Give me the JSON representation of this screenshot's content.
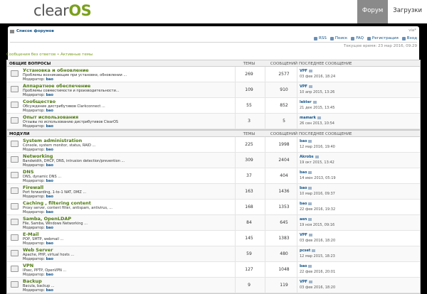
{
  "header": {
    "logo_prefix": "clear",
    "logo_suffix": "OS",
    "nav": [
      {
        "label": "Форум",
        "active": true
      },
      {
        "label": "Загрузки",
        "active": false
      }
    ]
  },
  "breadcrumbs": {
    "home": "Список форумов",
    "right": "via*",
    "toolbar": [
      "RSS",
      "Поиск",
      "FAQ",
      "Регистрация",
      "Вход"
    ],
    "time": "Текущее время: 23 мар 2016, 09:29"
  },
  "quicklinks": "Сообщения без ответов • Активные темы",
  "columns": {
    "topics": "ТЕМЫ",
    "posts": "СООБЩЕНИЙ",
    "last": "ПОСЛЕДНЕЕ СООБЩЕНИЕ"
  },
  "sections": [
    {
      "title": "ОБЩИЕ ВОПРОСЫ",
      "forums": [
        {
          "name": "Установка и обновление",
          "desc": "Проблемы возникающие при установке, обновлении ...",
          "mod_label": "Модератор:",
          "mod": "bao",
          "topics": "269",
          "posts": "2577",
          "last_by": "VPF",
          "last_date": "03 фев 2016, 18:24"
        },
        {
          "name": "Аппаратное обеспечение",
          "desc": "Проблемы совместимости и производительности...",
          "mod_label": "Модератор:",
          "mod": "bao",
          "topics": "109",
          "posts": "910",
          "last_by": "VPF",
          "last_date": "10 апр 2015, 13:26"
        },
        {
          "name": "Сообщество",
          "desc": "Обсуждение дистрибутивов Clarkconnect ...",
          "mod_label": "Модератор:",
          "mod": "bao",
          "topics": "55",
          "posts": "852",
          "last_by": "lekter",
          "last_date": "21 дек 2015, 13:45"
        },
        {
          "name": "Опыт использования",
          "desc": "Отзывы по использованию дистрибутивов ClearOS",
          "mod_label": "Модератор:",
          "mod": "bao",
          "topics": "3",
          "posts": "5",
          "last_by": "mamark",
          "last_date": "26 сен 2013, 10:54"
        }
      ]
    },
    {
      "title": "МОДУЛИ",
      "forums": [
        {
          "name": "System administration",
          "desc": "Console, system monitor, status, RAID ...",
          "mod_label": "Модератор:",
          "mod": "bao",
          "topics": "225",
          "posts": "1998",
          "last_by": "bao",
          "last_date": "12 мар 2016, 19:40"
        },
        {
          "name": "Networking",
          "desc": "Bandwidth, DHCP, DNS, intrusion detection/prevention ...",
          "mod_label": "Модератор:",
          "mod": "bao",
          "topics": "309",
          "posts": "2404",
          "last_by": "Akrobs",
          "last_date": "19 окт 2015, 13:42"
        },
        {
          "name": "DNS",
          "desc": "DNS, dynamic DNS ...",
          "mod_label": "Модератор:",
          "mod": "bao",
          "topics": "37",
          "posts": "404",
          "last_by": "bao",
          "last_date": "14 июн 2013, 05:19"
        },
        {
          "name": "Firewall",
          "desc": "Port forwarding, 1-to-1 NAT, DMZ ...",
          "mod_label": "Модератор:",
          "mod": "bao",
          "topics": "163",
          "posts": "1436",
          "last_by": "bao",
          "last_date": "10 мар 2016, 09:37"
        },
        {
          "name": "Caching , filtering content",
          "desc": "Proxy server, content filter, antispam, antivirus, ...",
          "mod_label": "Модератор:",
          "mod": "bao",
          "topics": "168",
          "posts": "1353",
          "last_by": "bao",
          "last_date": "22 фев 2016, 19:32"
        },
        {
          "name": "Samba, OpenLDAP",
          "desc": "File, Samba, Windows Networking ...",
          "mod_label": "Модератор:",
          "mod": "bao",
          "topics": "84",
          "posts": "645",
          "last_by": "aen",
          "last_date": "19 ноя 2015, 09:16"
        },
        {
          "name": "E-Mail",
          "desc": "POP, SMTP, webmail ...",
          "mod_label": "Модератор:",
          "mod": "bao",
          "topics": "145",
          "posts": "1383",
          "last_by": "VPF",
          "last_date": "03 фев 2016, 18:20"
        },
        {
          "name": "Web Server",
          "desc": "Apache, PHP, virtual hosts ...",
          "mod_label": "Модератор:",
          "mod": "bao",
          "topics": "59",
          "posts": "480",
          "last_by": "pcset",
          "last_date": "12 мар 2015, 18:23"
        },
        {
          "name": "VPN",
          "desc": "IPsec, PPTP, OpenVPN ...",
          "mod_label": "Модератор:",
          "mod": "bao",
          "topics": "127",
          "posts": "1048",
          "last_by": "bao",
          "last_date": "22 фев 2016, 20:01"
        },
        {
          "name": "Backup",
          "desc": "Bacula, backup ...",
          "mod_label": "Модератор:",
          "mod": "bao",
          "topics": "9",
          "posts": "119",
          "last_by": "VPF",
          "last_date": "03 фев 2016, 18:20"
        }
      ]
    }
  ]
}
